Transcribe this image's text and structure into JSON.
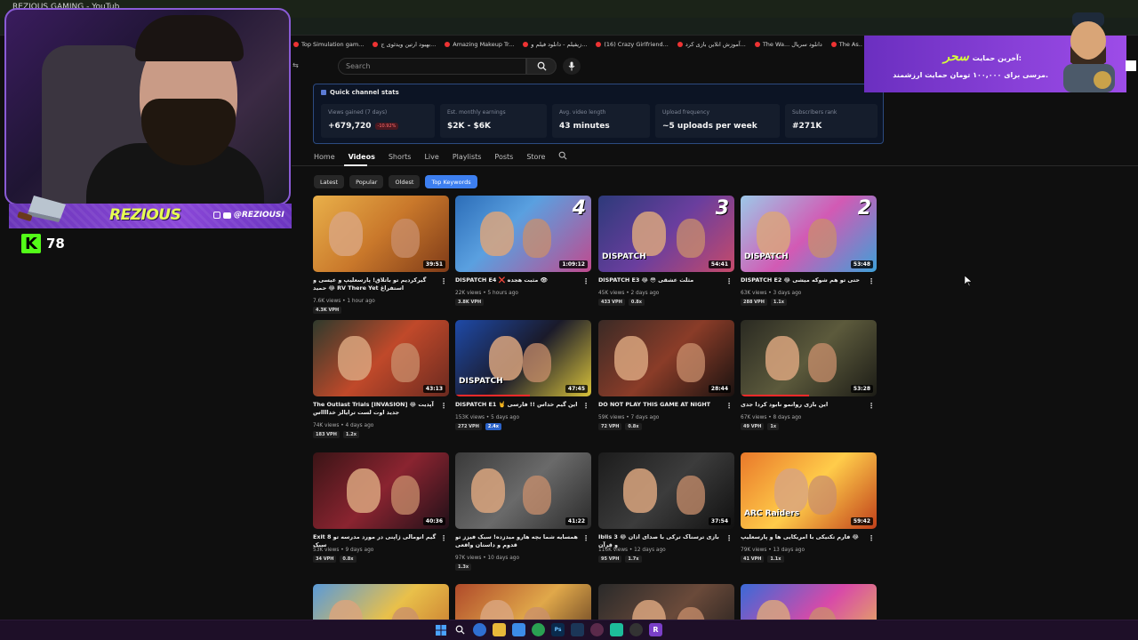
{
  "browser": {
    "active_tab_title": "REZIOUS GAMING - YouTube",
    "bookmarks": [
      {
        "label": "Top Simulation gam..."
      },
      {
        "label": "بهبود ارتین ویدئوی ج..."
      },
      {
        "label": "Amazing Makeup Tr..."
      },
      {
        "label": "زیفیلم - دانلود فیلم و..."
      },
      {
        "label": "(16) Crazy Girlfriend..."
      },
      {
        "label": "آموزش انلاین بازی کرد..."
      },
      {
        "label": "The Wa... دانلود سریال"
      },
      {
        "label": "The As... دانلود سریال"
      }
    ]
  },
  "search": {
    "placeholder": "Search"
  },
  "stats_panel": {
    "title": "Quick channel stats",
    "items": [
      {
        "label": "Views gained (7 days)",
        "value": "+679,720",
        "delta": "-10.92%"
      },
      {
        "label": "Est. monthly earnings",
        "value": "$2K - $6K"
      },
      {
        "label": "Avg. video length",
        "value": "43 minutes"
      },
      {
        "label": "Upload frequency",
        "value": "~5 uploads per week"
      },
      {
        "label": "Subscribers rank",
        "value": "#271K"
      }
    ]
  },
  "channel_tabs": [
    "Home",
    "Videos",
    "Shorts",
    "Live",
    "Playlists",
    "Posts",
    "Store"
  ],
  "active_tab": "Videos",
  "chips": [
    {
      "label": "Latest",
      "selected": false
    },
    {
      "label": "Popular",
      "selected": false
    },
    {
      "label": "Oldest",
      "selected": false
    },
    {
      "label": "Top Keywords",
      "selected": true
    }
  ],
  "videos": [
    {
      "title": "گیرکردیم تو باتلاق! پارسعلیپ و عیسی و حمید 😂 RV There Yet استفراغ",
      "meta": "7.6K views • 1 hour ago",
      "badges": [
        "4.3K VPH"
      ],
      "duration": "39:51",
      "thumb_text": "",
      "thumb_num": "",
      "progress": 0
    },
    {
      "title": "DISPATCH E4 ❌ مثبت هجده 👁",
      "meta": "22K views • 5 hours ago",
      "badges": [
        "3.8K VPH"
      ],
      "duration": "1:09:12",
      "thumb_text": "",
      "thumb_num": "4",
      "progress": 0
    },
    {
      "title": "DISPATCH E3 😂 😳 مثلث عشقی",
      "meta": "45K views • 2 days ago",
      "badges": [
        "433 VPH",
        "0.8x"
      ],
      "duration": "54:41",
      "thumb_text": "DISPATCH",
      "thumb_num": "3",
      "progress": 0
    },
    {
      "title": "DISPATCH E2 😂 حتی تو هم شوکه میشی",
      "meta": "63K views • 3 days ago",
      "badges": [
        "288 VPH",
        "1.1x"
      ],
      "duration": "53:48",
      "thumb_text": "DISPATCH",
      "thumb_num": "2",
      "progress": 0
    },
    {
      "title": "The Outlast Trials [INVASION] 😂 آپدیت جدید اوت لست ترایالز خدااااس",
      "meta": "74K views • 4 days ago",
      "badges": [
        "183 VPH",
        "1.2x"
      ],
      "duration": "43:13",
      "thumb_text": "",
      "thumb_num": "",
      "progress": 0
    },
    {
      "title": "DISPATCH E1 🤘 این گیم خداس !! فارسی",
      "meta": "153K views • 5 days ago",
      "badges": [
        "272 VPH",
        "2.4x"
      ],
      "duration": "47:45",
      "thumb_text": "DISPATCH",
      "thumb_num": "",
      "progress": 0.55
    },
    {
      "title": "DO NOT PLAY THIS GAME AT NIGHT",
      "meta": "59K views • 7 days ago",
      "badges": [
        "72 VPH",
        "0.8x"
      ],
      "duration": "28:44",
      "thumb_text": "",
      "thumb_num": "",
      "progress": 0
    },
    {
      "title": "این بازی روانمو نابود کردا جدی",
      "meta": "67K views • 8 days ago",
      "badges": [
        "49 VPH",
        "1x"
      ],
      "duration": "53:28",
      "thumb_text": "",
      "thumb_num": "",
      "progress": 0.5
    },
    {
      "title": "Exit 8 گیم انومالی ژاپنی در مورد مدرسه تو سبک",
      "meta": "53K views • 9 days ago",
      "badges": [
        "34 VPH",
        "0.8x"
      ],
      "duration": "40:36",
      "thumb_text": "",
      "thumb_num": "",
      "progress": 0
    },
    {
      "title": "همسایه شما بچه هارو میدزده! سبک فیزز تو قدوم و داستان واقعی",
      "meta": "97K views • 10 days ago",
      "badges": [
        "1.3x"
      ],
      "duration": "41:22",
      "thumb_text": "",
      "thumb_num": "",
      "progress": 0
    },
    {
      "title": "Iblis 3 😂 بازی ترسناک ترکی با صدای اذان و قرآن",
      "meta": "116K views • 12 days ago",
      "badges": [
        "95 VPH",
        "1.7x"
      ],
      "duration": "37:54",
      "thumb_text": "",
      "thumb_num": "",
      "progress": 0
    },
    {
      "title": "فارم تکنیکی با امریکایی ها و پارسعلیپ 😂",
      "meta": "79K views • 13 days ago",
      "badges": [
        "41 VPH",
        "1.1x"
      ],
      "duration": "59:42",
      "thumb_text": "ARC Raiders",
      "thumb_num": "",
      "progress": 0
    },
    {
      "title": "",
      "meta": "",
      "badges": [],
      "duration": "",
      "thumb_text": "",
      "thumb_num": "",
      "progress": 0
    },
    {
      "title": "",
      "meta": "",
      "badges": [],
      "duration": "",
      "thumb_text": "",
      "thumb_num": "",
      "progress": 0
    },
    {
      "title": "",
      "meta": "",
      "badges": [],
      "duration": "",
      "thumb_text": "",
      "thumb_num": "",
      "progress": 0
    },
    {
      "title": "",
      "meta": "",
      "badges": [],
      "duration": "",
      "thumb_text": "",
      "thumb_num": "",
      "progress": 0
    }
  ],
  "overlay": {
    "streamer_name": "REZIOUS",
    "handle": "@REZIOUSI",
    "kick_viewers": "78",
    "donation_line1_prefix": "آخرین حمایت:",
    "donation_name": "سحر",
    "donation_line2": "مرسی برای ۱۰۰,۰۰۰ تومان حمایت ارزشمند."
  },
  "colors": {
    "accent_blue": "#3d7ff0",
    "stats_border": "#2c4a80",
    "overlay_purple": "#8a47d8",
    "name_yellow": "#e7ff52",
    "kick_green": "#53fc18"
  }
}
